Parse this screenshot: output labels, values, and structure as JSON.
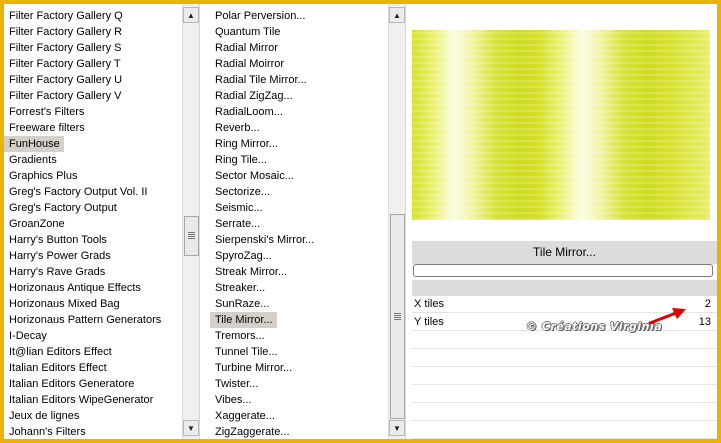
{
  "left_list": {
    "selected_index": 8,
    "items": [
      "Filter Factory Gallery Q",
      "Filter Factory Gallery R",
      "Filter Factory Gallery S",
      "Filter Factory Gallery T",
      "Filter Factory Gallery U",
      "Filter Factory Gallery V",
      "Forrest's Filters",
      "Freeware filters",
      "FunHouse",
      "Gradients",
      "Graphics Plus",
      "Greg's Factory Output Vol. II",
      "Greg's Factory Output",
      "GroanZone",
      "Harry's Button Tools",
      "Harry's Power Grads",
      "Harry's Rave Grads",
      "Horizonaus Antique Effects",
      "Horizonaus Mixed Bag",
      "Horizonaus Pattern Generators",
      "I-Decay",
      "It@lian Editors Effect",
      "Italian Editors Effect",
      "Italian Editors Generatore",
      "Italian Editors WipeGenerator",
      "Jeux de lignes",
      "Johann's Filters"
    ],
    "scroll_position": 0.54
  },
  "right_list": {
    "selected_index": 19,
    "items": [
      "Polar Perversion...",
      "Quantum Tile",
      "Radial Mirror",
      "Radial Moirror",
      "Radial Tile Mirror...",
      "Radial ZigZag...",
      "RadialLoom...",
      "Reverb...",
      "Ring Mirror...",
      "Ring Tile...",
      "Sector Mosaic...",
      "Sectorize...",
      "Seismic...",
      "Serrate...",
      "Sierpenski's Mirror...",
      "SpyroZag...",
      "Streak Mirror...",
      "Streaker...",
      "SunRaze...",
      "Tile Mirror...",
      "Tremors...",
      "Tunnel Tile...",
      "Turbine Mirror...",
      "Twister...",
      "Vibes...",
      "Xaggerate...",
      "ZigZaggerate..."
    ],
    "scroll_position": 1.0
  },
  "filter_panel": {
    "title": "Tile Mirror...",
    "params": [
      {
        "label": "X tiles",
        "value": "2"
      },
      {
        "label": "Y tiles",
        "value": "13"
      }
    ]
  },
  "watermark": "© Créations Virginia",
  "colors": {
    "border": "#e8b400",
    "selection": "#d4d0c8",
    "arrow": "#e00000"
  },
  "icons": {
    "scroll_up": "▲",
    "scroll_down": "▼"
  }
}
